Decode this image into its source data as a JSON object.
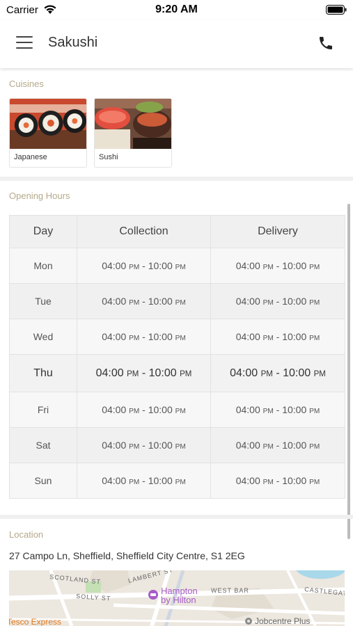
{
  "status_bar": {
    "carrier": "Carrier",
    "time": "9:20 AM"
  },
  "nav": {
    "title": "Sakushi",
    "menu_icon": "hamburger-icon",
    "call_icon": "phone-icon"
  },
  "cuisines": {
    "heading": "Cuisines",
    "items": [
      {
        "label": "Japanese"
      },
      {
        "label": "Sushi"
      }
    ]
  },
  "hours": {
    "heading": "Opening Hours",
    "columns": [
      "Day",
      "Collection",
      "Delivery"
    ],
    "rows": [
      {
        "day": "Mon",
        "collection": {
          "open": "04:00",
          "open_suffix": "PM",
          "close": "10:00",
          "close_suffix": "PM"
        },
        "delivery": {
          "open": "04:00",
          "open_suffix": "PM",
          "close": "10:00",
          "close_suffix": "PM"
        }
      },
      {
        "day": "Tue",
        "collection": {
          "open": "04:00",
          "open_suffix": "PM",
          "close": "10:00",
          "close_suffix": "PM"
        },
        "delivery": {
          "open": "04:00",
          "open_suffix": "PM",
          "close": "10:00",
          "close_suffix": "PM"
        }
      },
      {
        "day": "Wed",
        "collection": {
          "open": "04:00",
          "open_suffix": "PM",
          "close": "10:00",
          "close_suffix": "PM"
        },
        "delivery": {
          "open": "04:00",
          "open_suffix": "PM",
          "close": "10:00",
          "close_suffix": "PM"
        }
      },
      {
        "day": "Thu",
        "collection": {
          "open": "04:00",
          "open_suffix": "PM",
          "close": "10:00",
          "close_suffix": "PM"
        },
        "delivery": {
          "open": "04:00",
          "open_suffix": "PM",
          "close": "10:00",
          "close_suffix": "PM"
        }
      },
      {
        "day": "Fri",
        "collection": {
          "open": "04:00",
          "open_suffix": "PM",
          "close": "10:00",
          "close_suffix": "PM"
        },
        "delivery": {
          "open": "04:00",
          "open_suffix": "PM",
          "close": "10:00",
          "close_suffix": "PM"
        }
      },
      {
        "day": "Sat",
        "collection": {
          "open": "04:00",
          "open_suffix": "PM",
          "close": "10:00",
          "close_suffix": "PM"
        },
        "delivery": {
          "open": "04:00",
          "open_suffix": "PM",
          "close": "10:00",
          "close_suffix": "PM"
        }
      },
      {
        "day": "Sun",
        "collection": {
          "open": "04:00",
          "open_suffix": "PM",
          "close": "10:00",
          "close_suffix": "PM"
        },
        "delivery": {
          "open": "04:00",
          "open_suffix": "PM",
          "close": "10:00",
          "close_suffix": "PM"
        }
      }
    ],
    "highlighted_day": "Thu"
  },
  "location": {
    "heading": "Location",
    "address": "27 Campo Ln, Sheffield, Sheffield City Centre, S1 2EG",
    "map_labels": {
      "scotland_st": "SCOTLAND ST",
      "lambert_st": "LAMBERT ST",
      "solly_st": "SOLLY ST",
      "west_bar": "WEST BAR",
      "castlegate": "CASTLEGAT",
      "hampton_line1": "Hampton",
      "hampton_line2": "by Hilton",
      "tesco": "Tesco Express",
      "jobcentre": "Jobcentre Plus"
    }
  },
  "colors": {
    "section_heading": "#b5a98a",
    "map_poi_purple": "#a65cc7",
    "map_poi_orange": "#e07a1f"
  }
}
